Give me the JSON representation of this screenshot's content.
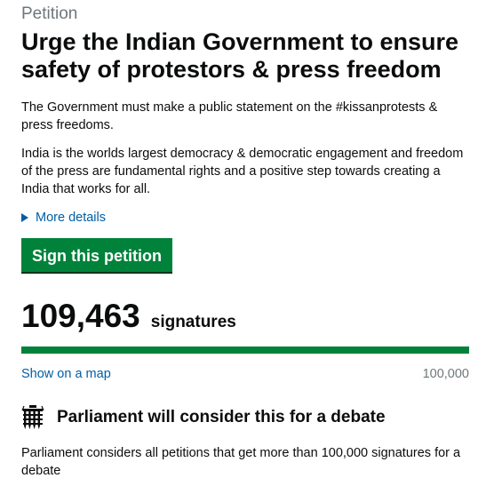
{
  "caption": "Petition",
  "title": "Urge the Indian Government to ensure safety of protestors & press freedom",
  "summary": "The Government must make a public statement on the #kissanprotests & press freedoms.",
  "background": "India is the worlds largest democracy & democratic engagement and freedom of the press are fundamental rights and a positive step towards creating a India that works for all.",
  "more_details_label": "More details",
  "sign_button_label": "Sign this petition",
  "signatures": {
    "count": "109,463",
    "label": "signatures",
    "progress_fraction": 1.0
  },
  "map_link_label": "Show on a map",
  "threshold": "100,000",
  "debate": {
    "icon": "portcullis-icon",
    "title": "Parliament will consider this for a debate",
    "text": "Parliament considers all petitions that get more than 100,000 signatures for a debate"
  },
  "colors": {
    "link": "#005ea5",
    "button": "#00823b",
    "progress": "#00823b",
    "text": "#0b0c0c",
    "secondary_text": "#6f777b"
  }
}
